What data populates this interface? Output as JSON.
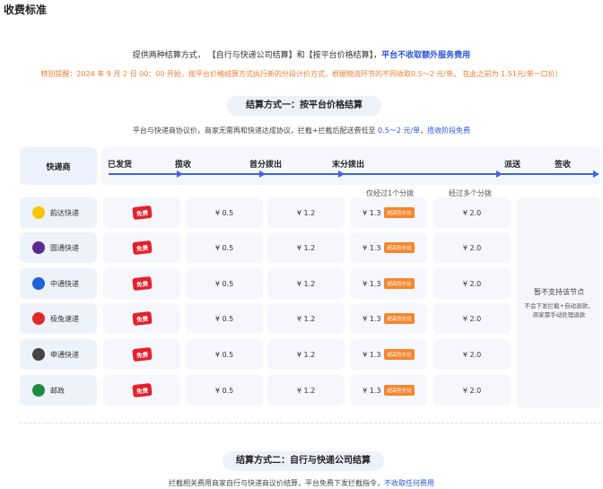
{
  "page_title": "收费标准",
  "intro": {
    "text": "提供两种结算方式， 【自行与快递公司结算】和【按平台价格结算】，",
    "highlight": "平台不收取额外服务费用"
  },
  "notice": "特别提醒：2024 年 9 月 2 日 00：00 开始，按平台价格结算方式执行新的分段计价方式，根据物流环节的不同收取0.5～2 元/单。 在此之前为 1.51元/单一口价）",
  "section1": {
    "title": "结算方式一：按平台价格结算",
    "desc_plain": "平台与快递商协议价，商家无需再和快递达成协议，拦截+拦截后配送费低至 ",
    "desc_price": "0.5～2 元/单",
    "desc_sep": "，",
    "desc_free": "揽收阶段免费"
  },
  "table": {
    "carrier_header": "快递商",
    "stages": [
      "已发货",
      "揽收",
      "首分拨出",
      "末分拨出",
      "派送",
      "签收"
    ],
    "notes": [
      "仅经过1个分拨",
      "经过多个分拨"
    ],
    "free_label": "免费",
    "value_tag": "超高性价比",
    "rows": [
      {
        "carrier": "韵达快递",
        "logo": "yunda-logo",
        "logo_color": "#f7c600",
        "c1": "¥ 0.5",
        "c2": "¥ 1.2",
        "c3": "¥ 1.3",
        "c4": "¥ 2.0"
      },
      {
        "carrier": "圆通快递",
        "logo": "yuantong-logo",
        "logo_color": "#5b2c8f",
        "c1": "¥ 0.5",
        "c2": "¥ 1.2",
        "c3": "¥ 1.3",
        "c4": "¥ 2.0"
      },
      {
        "carrier": "中通快递",
        "logo": "zhongtong-logo",
        "logo_color": "#1e63d6",
        "c1": "¥ 0.5",
        "c2": "¥ 1.2",
        "c3": "¥ 1.3",
        "c4": "¥ 2.0"
      },
      {
        "carrier": "极兔速递",
        "logo": "jitu-logo",
        "logo_color": "#e02a2a",
        "c1": "¥ 0.5",
        "c2": "¥ 1.2",
        "c3": "¥ 1.3",
        "c4": "¥ 2.0"
      },
      {
        "carrier": "申通快递",
        "logo": "shentong-logo",
        "logo_color": "#444444",
        "c1": "¥ 0.5",
        "c2": "¥ 1.2",
        "c3": "¥ 1.3",
        "c4": "¥ 2.0"
      },
      {
        "carrier": "邮政",
        "logo": "youzheng-logo",
        "logo_color": "#1e8a3e",
        "c1": "¥ 0.5",
        "c2": "¥ 1.2",
        "c3": "¥ 1.3",
        "c4": "¥ 2.0"
      }
    ],
    "unsupported_title": "暂不支持该节点",
    "unsupported_line1": "不会下发拦截+自动退款，",
    "unsupported_line2": "商家需手动处理退款"
  },
  "section2": {
    "title": "结算方式二：自行与快递公司结算",
    "desc_plain": "拦截相关费用商家自行与快递商议价结算，平台免费下发拦截指令，",
    "desc_free": "不收取任何费用"
  },
  "colors": {
    "accent_blue": "#2b55e0",
    "orange": "#ef7d2e",
    "red": "#e6202c"
  }
}
